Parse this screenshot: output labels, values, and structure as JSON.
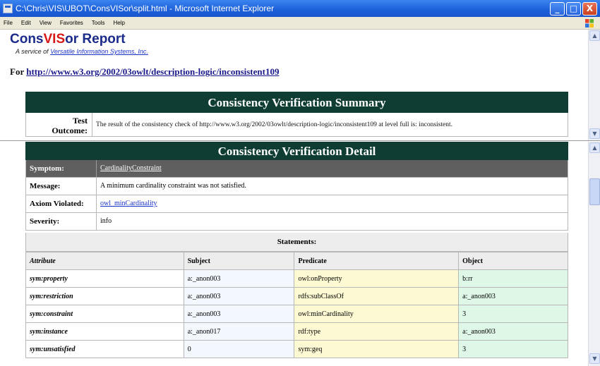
{
  "window": {
    "title": "C:\\Chris\\VIS\\UBOT\\ConsVISor\\split.html - Microsoft Internet Explorer",
    "minimize": "_",
    "maximize": "□",
    "close": "X"
  },
  "menu": [
    "File",
    "Edit",
    "View",
    "Favorites",
    "Tools",
    "Help"
  ],
  "report": {
    "brand_prefix": "Cons",
    "brand_vis": "VIS",
    "brand_suffix": "or Report",
    "service_prefix": "A service of ",
    "service_link": "Versatile Information Systems, Inc.",
    "for_label": "For ",
    "for_url": "http://www.w3.org/2002/03owlt/description-logic/inconsistent109"
  },
  "summary": {
    "title": "Consistency Verification Summary",
    "label_line1": "Test",
    "label_line2": "Outcome:",
    "text": "The result of the consistency check of http://www.w3.org/2002/03owlt/description-logic/inconsistent109 at level full is: inconsistent."
  },
  "detail": {
    "title": "Consistency Verification Detail",
    "symptom_label": "Symptom:",
    "symptom_value": "CardinalityConstraint",
    "message_label": "Message:",
    "message_value": "A minimum cardinality constraint was not satisfied.",
    "axiom_label": "Axiom Violated:",
    "axiom_value": "owl_minCardinality",
    "severity_label": "Severity:",
    "severity_value": "info"
  },
  "statements": {
    "title": "Statements:",
    "headers": [
      "Attribute",
      "Subject",
      "Predicate",
      "Object"
    ],
    "rows": [
      [
        "sym:property",
        "a:_anon003",
        "owl:onProperty",
        "b:rr"
      ],
      [
        "sym:restriction",
        "a:_anon003",
        "rdfs:subClassOf",
        "a:_anon003"
      ],
      [
        "sym:constraint",
        "a:_anon003",
        "owl:minCardinality",
        "3"
      ],
      [
        "sym:instance",
        "a:_anon017",
        "rdf:type",
        "a:_anon003"
      ],
      [
        "sym:unsatisfied",
        "0",
        "sym:geq",
        "3"
      ]
    ]
  }
}
